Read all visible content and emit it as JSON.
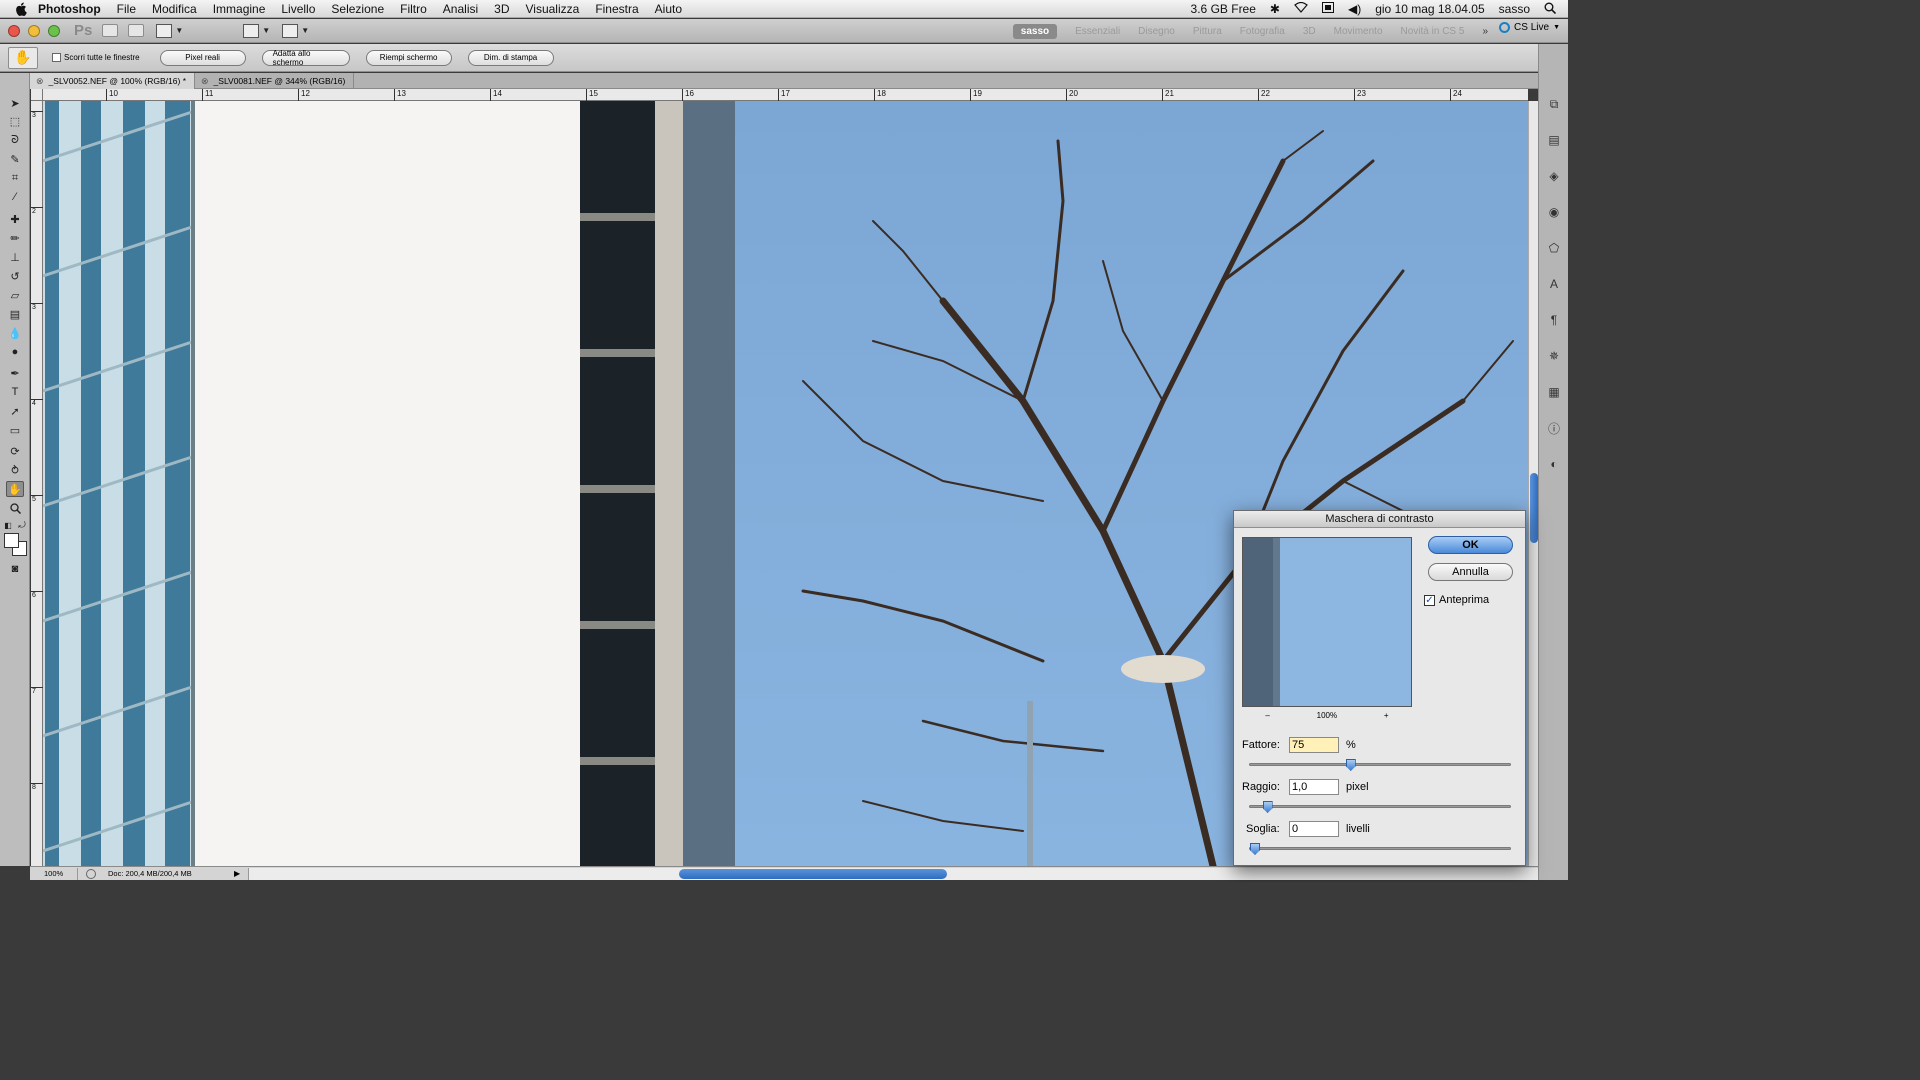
{
  "menubar": {
    "app": "Photoshop",
    "items": [
      "File",
      "Modifica",
      "Immagine",
      "Livello",
      "Selezione",
      "Filtro",
      "Analisi",
      "3D",
      "Visualizza",
      "Finestra",
      "Aiuto"
    ],
    "free_memory": "3.6 GB Free",
    "datetime": "gio 10 mag  18.04.05",
    "user": "sasso"
  },
  "appbar": {
    "logo": "Ps",
    "workspaces": [
      "sasso",
      "Essenziali",
      "Disegno",
      "Pittura",
      "Fotografia",
      "3D",
      "Movimento",
      "Novità in CS 5"
    ],
    "cs_live": "CS Live"
  },
  "options": {
    "scroll_all": "Scorri tutte le finestre",
    "buttons": [
      "Pixel reali",
      "Adatta allo schermo",
      "Riempi schermo",
      "Dim. di stampa"
    ]
  },
  "tabs": [
    {
      "label": "_SLV0052.NEF @ 100% (RGB/16) *",
      "active": true
    },
    {
      "label": "_SLV0081.NEF @ 344% (RGB/16)",
      "active": false
    }
  ],
  "ruler": {
    "top": [
      "10",
      "11",
      "12",
      "13",
      "14",
      "15",
      "16",
      "17",
      "18",
      "19",
      "20",
      "21",
      "22",
      "23",
      "24"
    ],
    "left": [
      "3",
      "2",
      "3",
      "3",
      "4",
      "5",
      "6",
      "7",
      "8"
    ]
  },
  "status": {
    "zoom": "100%",
    "doc": "Doc: 200,4 MB/200,4 MB"
  },
  "dialog": {
    "title": "Maschera di contrasto",
    "ok": "OK",
    "cancel": "Annulla",
    "preview_label": "Anteprima",
    "preview_checked": true,
    "zoom_minus": "–",
    "zoom_level": "100%",
    "zoom_plus": "+",
    "amount_label": "Fattore:",
    "amount_value": "75",
    "amount_unit": "%",
    "amount_fraction": 0.38,
    "radius_label": "Raggio:",
    "radius_value": "1,0",
    "radius_unit": "pixel",
    "radius_fraction": 0.05,
    "threshold_label": "Soglia:",
    "threshold_value": "0",
    "threshold_unit": "livelli",
    "threshold_fraction": 0.0
  },
  "colors": {
    "accent": "#3f7fd0",
    "sky": "#7fa9d6"
  }
}
